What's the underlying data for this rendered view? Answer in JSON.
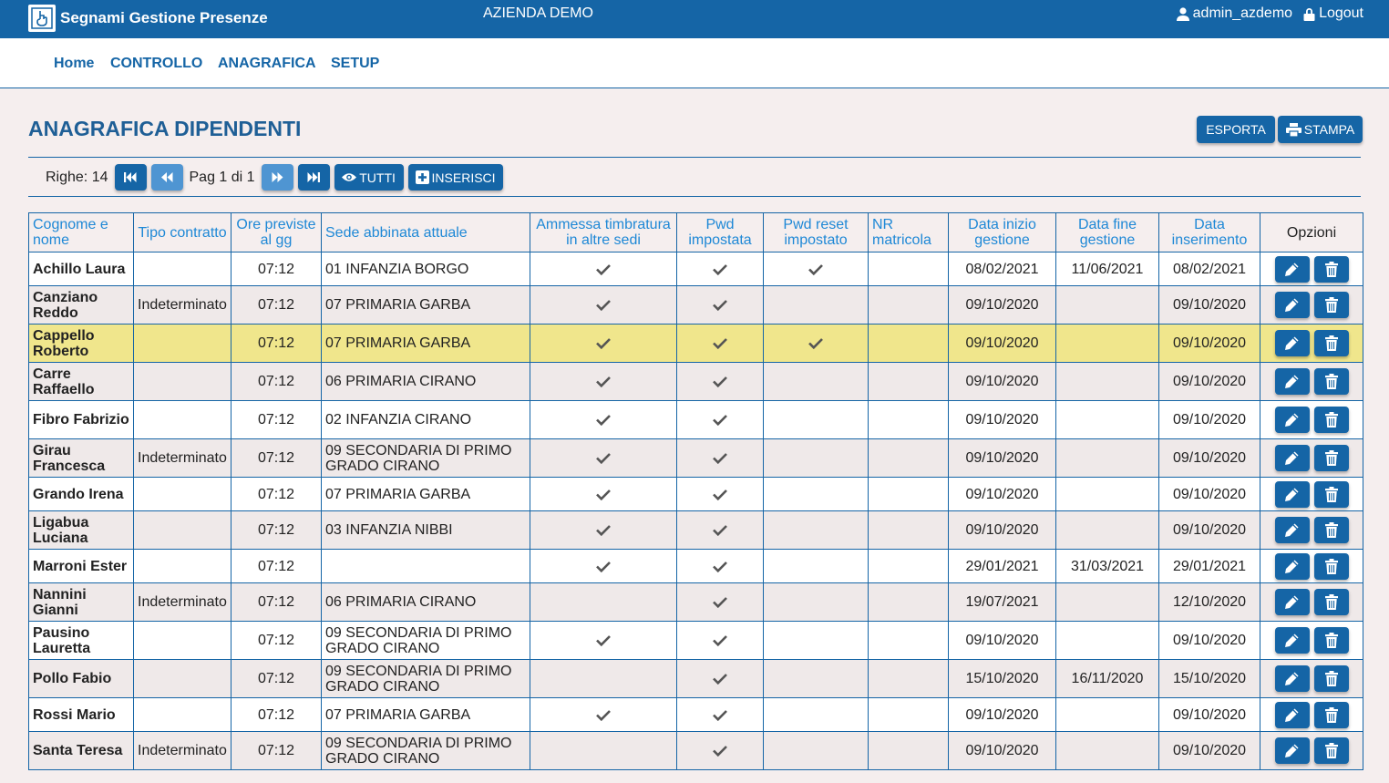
{
  "header": {
    "app_title": "Segnami Gestione Presenze",
    "company": "AZIENDA DEMO",
    "user": "admin_azdemo",
    "logout": "Logout"
  },
  "nav": {
    "items": [
      "Home",
      "CONTROLLO",
      "ANAGRAFICA",
      "SETUP"
    ]
  },
  "page": {
    "title": "ANAGRAFICA DIPENDENTI",
    "export_label": "ESPORTA",
    "print_label": "STAMPA"
  },
  "pager": {
    "rows_label": "Righe: 14",
    "page_label": "Pag 1 di 1",
    "all_label": "TUTTI",
    "insert_label": "INSERISCI"
  },
  "table": {
    "columns": [
      "Cognome e nome",
      "Tipo contratto",
      "Ore previste al gg",
      "Sede abbinata attuale",
      "Ammessa timbratura in altre sedi",
      "Pwd impostata",
      "Pwd reset impostato",
      "NR matricola",
      "Data inizio gestione",
      "Data fine gestione",
      "Data inserimento",
      "Opzioni"
    ],
    "rows": [
      {
        "name": "Achillo Laura",
        "contract": "",
        "hours": "07:12",
        "site": "01 INFANZIA BORGO",
        "other_sites": true,
        "pwd_set": true,
        "pwd_reset": true,
        "nr": "",
        "start": "08/02/2021",
        "end": "11/06/2021",
        "inserted": "08/02/2021"
      },
      {
        "name": "Canziano Reddo",
        "contract": "Indeterminato",
        "hours": "07:12",
        "site": "07 PRIMARIA GARBA",
        "other_sites": true,
        "pwd_set": true,
        "pwd_reset": false,
        "nr": "",
        "start": "09/10/2020",
        "end": "",
        "inserted": "09/10/2020"
      },
      {
        "name": "Cappello Roberto",
        "contract": "",
        "hours": "07:12",
        "site": "07 PRIMARIA GARBA",
        "other_sites": true,
        "pwd_set": true,
        "pwd_reset": true,
        "nr": "",
        "start": "09/10/2020",
        "end": "",
        "inserted": "09/10/2020",
        "selected": true
      },
      {
        "name": "Carre Raffaello",
        "contract": "",
        "hours": "07:12",
        "site": "06 PRIMARIA CIRANO",
        "other_sites": true,
        "pwd_set": true,
        "pwd_reset": false,
        "nr": "",
        "start": "09/10/2020",
        "end": "",
        "inserted": "09/10/2020"
      },
      {
        "name": "Fibro Fabrizio",
        "contract": "",
        "hours": "07:12",
        "site": "02 INFANZIA CIRANO",
        "other_sites": true,
        "pwd_set": true,
        "pwd_reset": false,
        "nr": "",
        "start": "09/10/2020",
        "end": "",
        "inserted": "09/10/2020"
      },
      {
        "name": "Girau Francesca",
        "contract": "Indeterminato",
        "hours": "07:12",
        "site": "09 SECONDARIA DI PRIMO GRADO CIRANO",
        "other_sites": true,
        "pwd_set": true,
        "pwd_reset": false,
        "nr": "",
        "start": "09/10/2020",
        "end": "",
        "inserted": "09/10/2020"
      },
      {
        "name": "Grando Irena",
        "contract": "",
        "hours": "07:12",
        "site": "07 PRIMARIA GARBA",
        "other_sites": true,
        "pwd_set": true,
        "pwd_reset": false,
        "nr": "",
        "start": "09/10/2020",
        "end": "",
        "inserted": "09/10/2020"
      },
      {
        "name": "Ligabua Luciana",
        "contract": "",
        "hours": "07:12",
        "site": "03 INFANZIA NIBBI",
        "other_sites": true,
        "pwd_set": true,
        "pwd_reset": false,
        "nr": "",
        "start": "09/10/2020",
        "end": "",
        "inserted": "09/10/2020"
      },
      {
        "name": "Marroni Ester",
        "contract": "",
        "hours": "07:12",
        "site": "",
        "other_sites": true,
        "pwd_set": true,
        "pwd_reset": false,
        "nr": "",
        "start": "29/01/2021",
        "end": "31/03/2021",
        "inserted": "29/01/2021"
      },
      {
        "name": "Nannini Gianni",
        "contract": "Indeterminato",
        "hours": "07:12",
        "site": "06 PRIMARIA CIRANO",
        "other_sites": false,
        "pwd_set": true,
        "pwd_reset": false,
        "nr": "",
        "start": "19/07/2021",
        "end": "",
        "inserted": "12/10/2020"
      },
      {
        "name": "Pausino Lauretta",
        "contract": "",
        "hours": "07:12",
        "site": "09 SECONDARIA DI PRIMO GRADO CIRANO",
        "other_sites": true,
        "pwd_set": true,
        "pwd_reset": false,
        "nr": "",
        "start": "09/10/2020",
        "end": "",
        "inserted": "09/10/2020"
      },
      {
        "name": "Pollo Fabio",
        "contract": "",
        "hours": "07:12",
        "site": "09 SECONDARIA DI PRIMO GRADO CIRANO",
        "other_sites": false,
        "pwd_set": true,
        "pwd_reset": false,
        "nr": "",
        "start": "15/10/2020",
        "end": "16/11/2020",
        "inserted": "15/10/2020"
      },
      {
        "name": "Rossi Mario",
        "contract": "",
        "hours": "07:12",
        "site": "07 PRIMARIA GARBA",
        "other_sites": true,
        "pwd_set": true,
        "pwd_reset": false,
        "nr": "",
        "start": "09/10/2020",
        "end": "",
        "inserted": "09/10/2020"
      },
      {
        "name": "Santa Teresa",
        "contract": "Indeterminato",
        "hours": "07:12",
        "site": "09 SECONDARIA DI PRIMO GRADO CIRANO",
        "other_sites": false,
        "pwd_set": true,
        "pwd_reset": false,
        "nr": "",
        "start": "09/10/2020",
        "end": "",
        "inserted": "09/10/2020"
      }
    ]
  },
  "icons": {
    "logo": "logo-icon",
    "user": "user-icon",
    "logout": "lock-icon",
    "print": "printer-icon",
    "first": "first-page-icon",
    "prev": "prev-page-icon",
    "next": "next-page-icon",
    "last": "last-page-icon",
    "all": "eye-icon",
    "insert": "plus-square-icon",
    "check": "check-icon",
    "edit": "pencil-icon",
    "delete": "trash-icon"
  },
  "colors": {
    "primary": "#1565a6",
    "header_text": "#1e88d6",
    "selected_row": "#f0e68c",
    "background": "#f5eeee"
  }
}
